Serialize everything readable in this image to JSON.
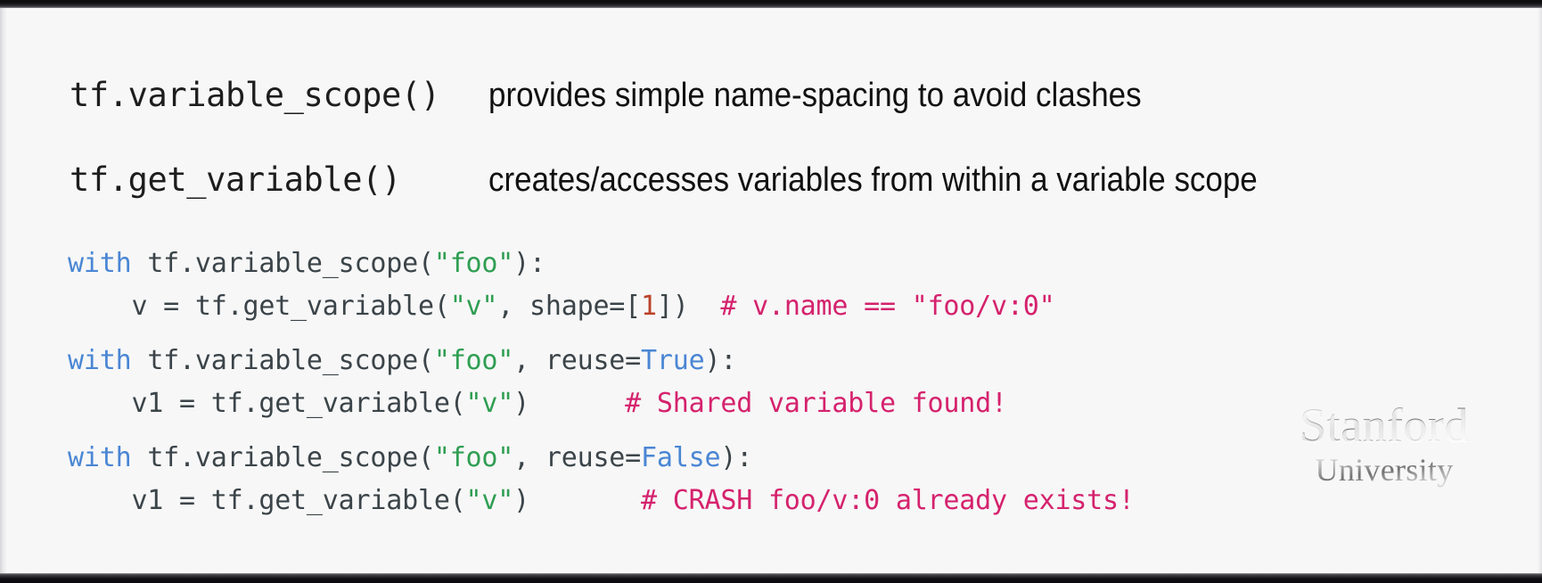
{
  "slide": {
    "background_color": "#f7f7f7",
    "headings": [
      {
        "api": "tf.variable_scope()",
        "description": "provides simple name-spacing to avoid clashes"
      },
      {
        "api": "tf.get_variable()",
        "description": "creates/accesses variables from within a variable scope"
      }
    ],
    "code": {
      "language": "python",
      "colors": {
        "keyword": "#4a86d4",
        "string": "#2f9e52",
        "number": "#bb432a",
        "comment": "#d5226d",
        "boolean": "#4a86d4",
        "plain": "#3b4449"
      },
      "lines": [
        {
          "gap": false,
          "tokens": [
            {
              "t": "with",
              "c": "kw"
            },
            {
              "t": " tf.variable_scope(",
              "c": "plain"
            },
            {
              "t": "\"foo\"",
              "c": "str"
            },
            {
              "t": "):",
              "c": "plain"
            }
          ]
        },
        {
          "gap": false,
          "tokens": [
            {
              "t": "    v = tf.get_variable(",
              "c": "plain"
            },
            {
              "t": "\"v\"",
              "c": "str"
            },
            {
              "t": ", shape=[",
              "c": "plain"
            },
            {
              "t": "1",
              "c": "num"
            },
            {
              "t": "])  ",
              "c": "plain"
            },
            {
              "t": "# v.name == \"foo/v:0\"",
              "c": "cmt"
            }
          ]
        },
        {
          "gap": true,
          "tokens": [
            {
              "t": "with",
              "c": "kw"
            },
            {
              "t": " tf.variable_scope(",
              "c": "plain"
            },
            {
              "t": "\"foo\"",
              "c": "str"
            },
            {
              "t": ", reuse=",
              "c": "plain"
            },
            {
              "t": "True",
              "c": "bool"
            },
            {
              "t": "):",
              "c": "plain"
            }
          ]
        },
        {
          "gap": false,
          "tokens": [
            {
              "t": "    v1 = tf.get_variable(",
              "c": "plain"
            },
            {
              "t": "\"v\"",
              "c": "str"
            },
            {
              "t": ")      ",
              "c": "plain"
            },
            {
              "t": "# Shared variable found!",
              "c": "cmt"
            }
          ]
        },
        {
          "gap": true,
          "tokens": [
            {
              "t": "with",
              "c": "kw"
            },
            {
              "t": " tf.variable_scope(",
              "c": "plain"
            },
            {
              "t": "\"foo\"",
              "c": "str"
            },
            {
              "t": ", reuse=",
              "c": "plain"
            },
            {
              "t": "False",
              "c": "bool"
            },
            {
              "t": "):",
              "c": "plain"
            }
          ]
        },
        {
          "gap": false,
          "tokens": [
            {
              "t": "    v1 = tf.get_variable(",
              "c": "plain"
            },
            {
              "t": "\"v\"",
              "c": "str"
            },
            {
              "t": ")       ",
              "c": "plain"
            },
            {
              "t": "# CRASH foo/v:0 already exists!",
              "c": "cmt"
            }
          ]
        }
      ]
    },
    "logo": {
      "brand": "Stanford",
      "sub": "University"
    }
  }
}
